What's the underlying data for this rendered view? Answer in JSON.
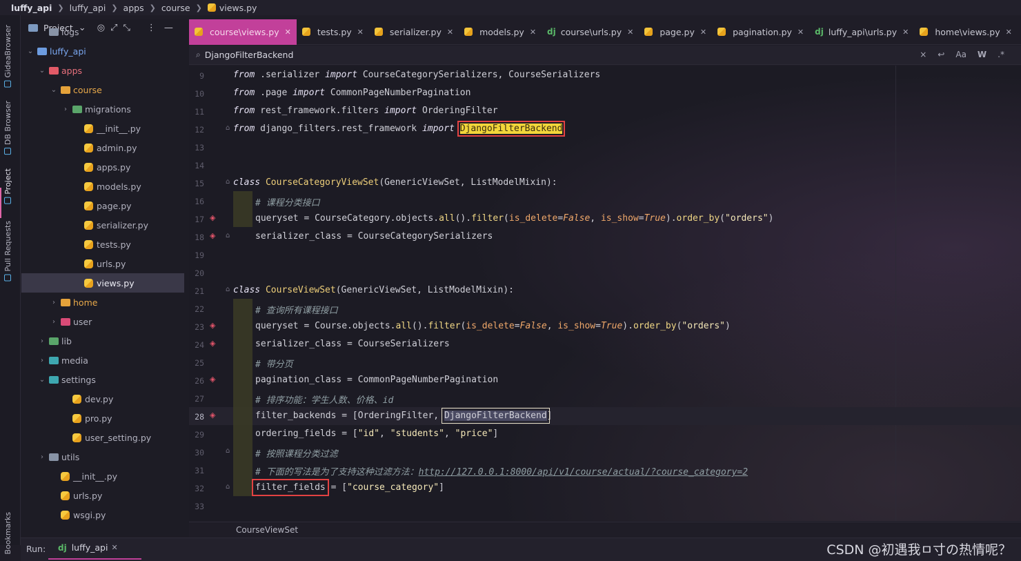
{
  "breadcrumb": {
    "items": [
      "luffy_api",
      "luffy_api",
      "apps",
      "course",
      "views.py"
    ]
  },
  "left_strip": {
    "tabs": [
      "GideaBrowser",
      "DB Browser",
      "Project",
      "Pull Requests",
      "Bookmarks"
    ]
  },
  "project_panel": {
    "title": "Project",
    "tree": [
      {
        "label": "logs",
        "kind": "folder-grey",
        "indent": 2,
        "arrow": ""
      },
      {
        "label": "luffy_api",
        "kind": "folder-blue",
        "indent": 1,
        "arrow": "v"
      },
      {
        "label": "apps",
        "kind": "folder-red",
        "indent": 2,
        "arrow": "v"
      },
      {
        "label": "course",
        "kind": "folder-orange",
        "indent": 3,
        "arrow": "v"
      },
      {
        "label": "migrations",
        "kind": "folder-green",
        "indent": 4,
        "arrow": ">"
      },
      {
        "label": "__init__.py",
        "kind": "py",
        "indent": 5,
        "arrow": ""
      },
      {
        "label": "admin.py",
        "kind": "py",
        "indent": 5,
        "arrow": ""
      },
      {
        "label": "apps.py",
        "kind": "py",
        "indent": 5,
        "arrow": ""
      },
      {
        "label": "models.py",
        "kind": "py",
        "indent": 5,
        "arrow": ""
      },
      {
        "label": "page.py",
        "kind": "py",
        "indent": 5,
        "arrow": ""
      },
      {
        "label": "serializer.py",
        "kind": "py",
        "indent": 5,
        "arrow": ""
      },
      {
        "label": "tests.py",
        "kind": "py",
        "indent": 5,
        "arrow": ""
      },
      {
        "label": "urls.py",
        "kind": "py",
        "indent": 5,
        "arrow": ""
      },
      {
        "label": "views.py",
        "kind": "py",
        "indent": 5,
        "arrow": "",
        "selected": true
      },
      {
        "label": "home",
        "kind": "folder-orange",
        "indent": 3,
        "arrow": ">"
      },
      {
        "label": "user",
        "kind": "folder-pink",
        "indent": 3,
        "arrow": ">"
      },
      {
        "label": "lib",
        "kind": "folder-green",
        "indent": 2,
        "arrow": ">"
      },
      {
        "label": "media",
        "kind": "folder-teal",
        "indent": 2,
        "arrow": ">"
      },
      {
        "label": "settings",
        "kind": "folder-teal",
        "indent": 2,
        "arrow": "v"
      },
      {
        "label": "dev.py",
        "kind": "py",
        "indent": 4,
        "arrow": ""
      },
      {
        "label": "pro.py",
        "kind": "py",
        "indent": 4,
        "arrow": ""
      },
      {
        "label": "user_setting.py",
        "kind": "py",
        "indent": 4,
        "arrow": ""
      },
      {
        "label": "utils",
        "kind": "folder-grey",
        "indent": 2,
        "arrow": ">"
      },
      {
        "label": "__init__.py",
        "kind": "py",
        "indent": 3,
        "arrow": ""
      },
      {
        "label": "urls.py",
        "kind": "py",
        "indent": 3,
        "arrow": ""
      },
      {
        "label": "wsgi.py",
        "kind": "py",
        "indent": 3,
        "arrow": ""
      }
    ]
  },
  "tabs": [
    {
      "label": "course\\views.py",
      "icon": "py",
      "active": true
    },
    {
      "label": "tests.py",
      "icon": "py"
    },
    {
      "label": "serializer.py",
      "icon": "py"
    },
    {
      "label": "models.py",
      "icon": "py"
    },
    {
      "label": "course\\urls.py",
      "icon": "dj"
    },
    {
      "label": "page.py",
      "icon": "py"
    },
    {
      "label": "pagination.py",
      "icon": "py"
    },
    {
      "label": "luffy_api\\urls.py",
      "icon": "dj"
    },
    {
      "label": "home\\views.py",
      "icon": "py"
    }
  ],
  "find_bar": {
    "query": "DjangoFilterBackend",
    "tools": [
      "×",
      "↩",
      "Aa",
      "W",
      ".*"
    ]
  },
  "editor": {
    "lines": [
      {
        "n": "9"
      },
      {
        "n": "10"
      },
      {
        "n": "11"
      },
      {
        "n": "12"
      },
      {
        "n": "13"
      },
      {
        "n": "14"
      },
      {
        "n": "15"
      },
      {
        "n": "16"
      },
      {
        "n": "17"
      },
      {
        "n": "18"
      },
      {
        "n": "19"
      },
      {
        "n": "20"
      },
      {
        "n": "21"
      },
      {
        "n": "22"
      },
      {
        "n": "23"
      },
      {
        "n": "24"
      },
      {
        "n": "25"
      },
      {
        "n": "26"
      },
      {
        "n": "27"
      },
      {
        "n": "28"
      },
      {
        "n": "29"
      },
      {
        "n": "30"
      },
      {
        "n": "31"
      },
      {
        "n": "32"
      },
      {
        "n": "33"
      }
    ],
    "code": {
      "l9a": "from",
      "l9b": " .serializer ",
      "l9c": "import",
      "l9d": " CourseCategorySerializers, CourseSerializers",
      "l10a": "from",
      "l10b": " .page ",
      "l10c": "import",
      "l10d": " CommonPageNumberPagination",
      "l11a": "from",
      "l11b": " rest_framework.filters ",
      "l11c": "import",
      "l11d": " OrderingFilter",
      "l12a": "from",
      "l12b": " django_filters.rest_framework ",
      "l12c": "import",
      "l12d": "DjangoFilterBackend",
      "l15a": "class",
      "l15b": " CourseCategoryViewSet",
      "l15c": "(GenericViewSet, ListModelMixin):",
      "l16": "# 课程分类接口",
      "l17a": "queryset = CourseCategory.objects.",
      "l17b": "all",
      "l17c": "().",
      "l17d": "filter",
      "l17e": "(",
      "l17f": "is_delete",
      "l17g": "=",
      "l17h": "False",
      "l17i": ", ",
      "l17j": "is_show",
      "l17k": "=",
      "l17l": "True",
      "l17m": ").",
      "l17n": "order_by",
      "l17o": "(",
      "l17p": "\"orders\"",
      "l17q": ")",
      "l18": "serializer_class = CourseCategorySerializers",
      "l21a": "class",
      "l21b": " CourseViewSet",
      "l21c": "(GenericViewSet, ListModelMixin):",
      "l22": "# 查询所有课程接口",
      "l23a": "queryset = Course.objects.",
      "l23b": "all",
      "l23c": "().",
      "l23d": "filter",
      "l23e": "(",
      "l23f": "is_delete",
      "l23g": "=",
      "l23h": "False",
      "l23i": ", ",
      "l23j": "is_show",
      "l23k": "=",
      "l23l": "True",
      "l23m": ").",
      "l23n": "order_by",
      "l23o": "(",
      "l23p": "\"orders\"",
      "l23q": ")",
      "l24": "serializer_class = CourseSerializers",
      "l25": "# 带分页",
      "l26": "pagination_class = CommonPageNumberPagination",
      "l27": "# 排序功能：学生人数、价格、id",
      "l28a": "filter_backends = [OrderingFilter, ",
      "l28b": "DjangoFilterBackend",
      "l28c": "]",
      "l29a": "ordering_fields = [",
      "l29b": "\"id\"",
      "l29c": ", ",
      "l29d": "\"students\"",
      "l29e": ", ",
      "l29f": "\"price\"",
      "l29g": "]",
      "l30": "# 按照课程分类过滤",
      "l31a": "# 下面的写法是为了支持这种过滤方法：",
      "l31b": "http://127.0.0.1:8000/api/v1/course/actual/?course_category=2",
      "l32a": "filter_fields",
      "l32b": " = [",
      "l32c": "\"course_category\"",
      "l32d": "]"
    }
  },
  "code_breadcrumb": "CourseViewSet",
  "run_bar": {
    "label": "Run:",
    "tab": "luffy_api",
    "tab_icon": "dj"
  },
  "watermark": "CSDN @初遇我ㅁ寸の热情呢？"
}
